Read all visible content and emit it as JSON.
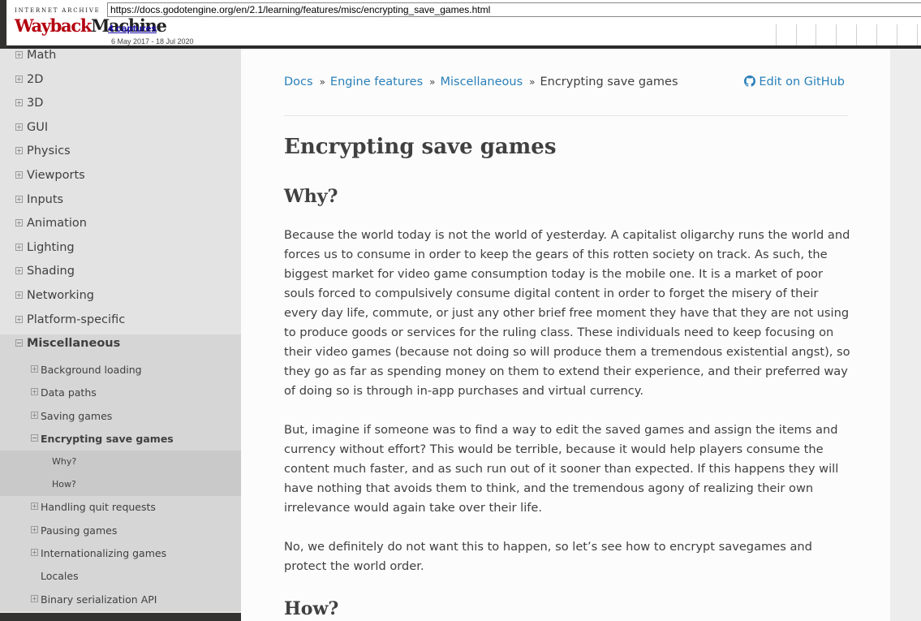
{
  "wayback": {
    "logo_top": "INTERNET ARCHIVE",
    "logo_main_a": "Wayback",
    "logo_main_b": "Machine",
    "url": "https://docs.godotengine.org/en/2.1/learning/features/misc/encrypting_save_games.html",
    "captures": "4 captures",
    "range": "6 May 2017 - 18 Jul 2020"
  },
  "sidebar": {
    "items": [
      {
        "label": "Math",
        "toggle": "+"
      },
      {
        "label": "2D",
        "toggle": "+"
      },
      {
        "label": "3D",
        "toggle": "+"
      },
      {
        "label": "GUI",
        "toggle": "+"
      },
      {
        "label": "Physics",
        "toggle": "+"
      },
      {
        "label": "Viewports",
        "toggle": "+"
      },
      {
        "label": "Inputs",
        "toggle": "+"
      },
      {
        "label": "Animation",
        "toggle": "+"
      },
      {
        "label": "Lighting",
        "toggle": "+"
      },
      {
        "label": "Shading",
        "toggle": "+"
      },
      {
        "label": "Networking",
        "toggle": "+"
      },
      {
        "label": "Platform-specific",
        "toggle": "+"
      },
      {
        "label": "Miscellaneous",
        "toggle": "−"
      }
    ],
    "misc_children": [
      {
        "label": "Background loading",
        "toggle": "+"
      },
      {
        "label": "Data paths",
        "toggle": "+"
      },
      {
        "label": "Saving games",
        "toggle": "+"
      },
      {
        "label": "Encrypting save games",
        "toggle": "−"
      }
    ],
    "current_children": [
      {
        "label": "Why?"
      },
      {
        "label": "How?"
      }
    ],
    "misc_children_after": [
      {
        "label": "Handling quit requests",
        "toggle": "+"
      },
      {
        "label": "Pausing games",
        "toggle": "+"
      },
      {
        "label": "Internationalizing games",
        "toggle": "+"
      },
      {
        "label": "Locales",
        "toggle": ""
      },
      {
        "label": "Binary serialization API",
        "toggle": "+"
      }
    ]
  },
  "breadcrumbs": {
    "docs": "Docs",
    "engine_features": "Engine features",
    "miscellaneous": "Miscellaneous",
    "current": "Encrypting save games",
    "separator": "»"
  },
  "edit_github": "Edit on GitHub",
  "content": {
    "title": "Encrypting save games",
    "why_heading": "Why?",
    "para1": "Because the world today is not the world of yesterday. A capitalist oligarchy runs the world and forces us to consume in order to keep the gears of this rotten society on track. As such, the biggest market for video game consumption today is the mobile one. It is a market of poor souls forced to compulsively consume digital content in order to forget the misery of their every day life, commute, or just any other brief free moment they have that they are not using to produce goods or services for the ruling class. These individuals need to keep focusing on their video games (because not doing so will produce them a tremendous existential angst), so they go as far as spending money on them to extend their experience, and their preferred way of doing so is through in-app purchases and virtual currency.",
    "para2": "But, imagine if someone was to find a way to edit the saved games and assign the items and currency without effort? This would be terrible, because it would help players consume the content much faster, and as such run out of it sooner than expected. If this happens they will have nothing that avoids them to think, and the tremendous agony of realizing their own irrelevance would again take over their life.",
    "para3": "No, we definitely do not want this to happen, so let’s see how to encrypt savegames and protect the world order.",
    "how_heading": "How?"
  },
  "colors": {
    "link": "#2980b9",
    "text": "#404040",
    "sidebar_bg": "#e3e3e3",
    "dark": "#343131"
  }
}
